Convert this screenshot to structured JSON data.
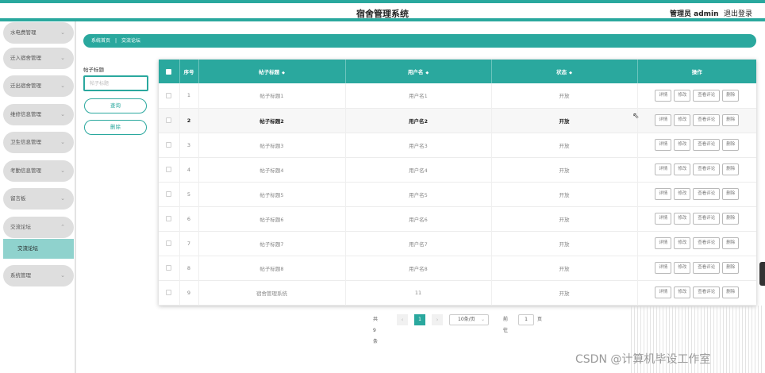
{
  "header": {
    "title": "宿舍管理系统",
    "user": "管理员 admin",
    "logout": "退出登录"
  },
  "sidebar": {
    "items": [
      {
        "label": "水电费管理"
      },
      {
        "label": "迁入宿舍管理"
      },
      {
        "label": "迁出宿舍管理"
      },
      {
        "label": "维修信息管理"
      },
      {
        "label": "卫生信息管理"
      },
      {
        "label": "考勤信息管理"
      },
      {
        "label": "留言板"
      },
      {
        "label": "交流论坛"
      },
      {
        "label": "系统管理"
      }
    ],
    "sub_item": "交流论坛"
  },
  "breadcrumb": {
    "home": "系统首页",
    "current": "交流论坛"
  },
  "search": {
    "label": "帖子标题",
    "placeholder": "帖子标题",
    "query_button": "查询",
    "delete_button": "删除"
  },
  "table": {
    "columns": [
      "序号",
      "帖子标题",
      "用户名",
      "状态",
      "操作"
    ],
    "actions": [
      "详情",
      "修改",
      "查看评论",
      "删除"
    ],
    "rows": [
      {
        "index": "1",
        "title": "帖子标题1",
        "user": "用户名1",
        "status": "开放"
      },
      {
        "index": "2",
        "title": "帖子标题2",
        "user": "用户名2",
        "status": "开放"
      },
      {
        "index": "3",
        "title": "帖子标题3",
        "user": "用户名3",
        "status": "开放"
      },
      {
        "index": "4",
        "title": "帖子标题4",
        "user": "用户名4",
        "status": "开放"
      },
      {
        "index": "5",
        "title": "帖子标题5",
        "user": "用户名5",
        "status": "开放"
      },
      {
        "index": "6",
        "title": "帖子标题6",
        "user": "用户名6",
        "status": "开放"
      },
      {
        "index": "7",
        "title": "帖子标题7",
        "user": "用户名7",
        "status": "开放"
      },
      {
        "index": "8",
        "title": "帖子标题8",
        "user": "用户名8",
        "status": "开放"
      },
      {
        "index": "9",
        "title": "宿舍管理系统",
        "user": "11",
        "status": "开放"
      }
    ]
  },
  "pagination": {
    "total": "共 9 条",
    "current": "1",
    "page_size": "10条/页",
    "goto": "前往",
    "goto_value": "1",
    "page_suffix": "页"
  },
  "watermark": "CSDN @计算机毕设工作室",
  "colors": {
    "accent": "#2aa89e",
    "sidebar_item": "#dedede",
    "sidebar_active": "#8fd2cd"
  },
  "icons": {
    "sort": "sort-icon",
    "chevron": "chevron-down-icon",
    "cursor": "cursor-icon"
  }
}
